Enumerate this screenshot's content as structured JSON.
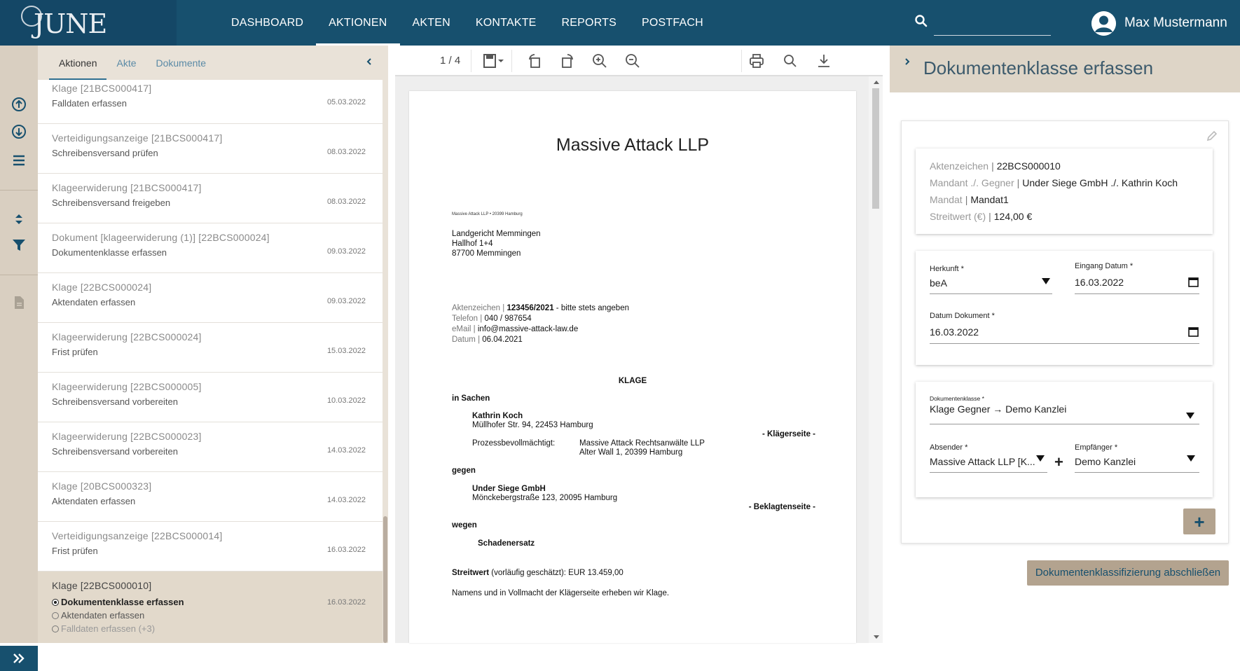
{
  "app": {
    "logo_text": "JUNE"
  },
  "nav": {
    "items": [
      {
        "label": "DASHBOARD"
      },
      {
        "label": "AKTIONEN"
      },
      {
        "label": "AKTEN"
      },
      {
        "label": "KONTAKTE"
      },
      {
        "label": "REPORTS"
      },
      {
        "label": "POSTFACH"
      }
    ],
    "active": "AKTIONEN"
  },
  "user": {
    "name": "Max Mustermann"
  },
  "list_panel": {
    "tabs": [
      {
        "label": "Aktionen"
      },
      {
        "label": "Akte"
      },
      {
        "label": "Dokumente"
      }
    ],
    "items": [
      {
        "title": "Klage [21BCS000417]",
        "sub": "Falldaten erfassen",
        "date": "05.03.2022"
      },
      {
        "title": "Verteidigungsanzeige [21BCS000417]",
        "sub": "Schreibensversand prüfen",
        "date": "08.03.2022"
      },
      {
        "title": "Klageerwiderung [21BCS000417]",
        "sub": "Schreibensversand freigeben",
        "date": "08.03.2022"
      },
      {
        "title": "Dokument [klageerwiderung (1)] [22BCS000024]",
        "sub": "Dokumentenklasse erfassen",
        "date": "09.03.2022"
      },
      {
        "title": "Klage [22BCS000024]",
        "sub": "Aktendaten erfassen",
        "date": "09.03.2022"
      },
      {
        "title": "Klageerwiderung [22BCS000024]",
        "sub": "Frist prüfen",
        "date": "15.03.2022"
      },
      {
        "title": "Klageerwiderung [22BCS000005]",
        "sub": "Schreibensversand vorbereiten",
        "date": "10.03.2022"
      },
      {
        "title": "Klageerwiderung [22BCS000023]",
        "sub": "Schreibensversand vorbereiten",
        "date": "14.03.2022"
      },
      {
        "title": "Klage [20BCS000323]",
        "sub": "Aktendaten erfassen",
        "date": "14.03.2022"
      },
      {
        "title": "Verteidigungsanzeige [22BCS000014]",
        "sub": "Frist prüfen",
        "date": "16.03.2022"
      }
    ],
    "selected": {
      "title": "Klage [22BCS000010]",
      "date": "16.03.2022",
      "steps": [
        {
          "label": "Dokumentenklasse erfassen"
        },
        {
          "label": "Aktendaten erfassen"
        },
        {
          "label": "Falldaten erfassen (+3)"
        }
      ]
    }
  },
  "viewer": {
    "page_indicator": "1 / 4",
    "document": {
      "firm": "Massive Attack LLP",
      "sender_line": "Massive Attack LLP • 20399 Hamburg",
      "recipient": [
        "Landgericht Memmingen",
        "Hallhof 1+4",
        "87700 Memmingen"
      ],
      "meta": [
        {
          "label": "Aktenzeichen |",
          "value": "123456/2021",
          "suffix": " - bitte stets angeben"
        },
        {
          "label": "Telefon |",
          "value": "040 / 987654",
          "suffix": ""
        },
        {
          "label": "eMail |",
          "value": "info@massive-attack-law.de",
          "suffix": ""
        },
        {
          "label": "Datum |",
          "value": "06.04.2021",
          "suffix": ""
        }
      ],
      "heading": "KLAGE",
      "in_sachen": "in Sachen",
      "plaintiff_name": "Kathrin Koch",
      "plaintiff_address": "Müllhofer Str. 94, 22453 Hamburg",
      "plaintiff_side": "- Klägerseite -",
      "counsel_label": "Prozessbevollmächtigt:",
      "counsel_name": "Massive Attack Rechtsanwälte LLP",
      "counsel_address": "Alter Wall 1, 20399 Hamburg",
      "gegen": "gegen",
      "defendant_name": "Under Siege GmbH",
      "defendant_address": "Mönckebergstraße 123, 20095 Hamburg",
      "defendant_side": "- Beklagtenseite -",
      "wegen": "wegen",
      "subject": "Schadenersatz",
      "streitwert_label": "Streitwert",
      "streitwert_text": " (vorläufig geschätzt): EUR 13.459,00",
      "closing": "Namens und in Vollmacht der Klägerseite erheben wir Klage."
    }
  },
  "right_panel": {
    "title": "Dokumentenklasse erfassen",
    "info": [
      {
        "label": "Aktenzeichen",
        "value": "22BCS000010"
      },
      {
        "label": "Mandant ./. Gegner",
        "value": "Under Siege GmbH ./. Kathrin Koch"
      },
      {
        "label": "Mandat",
        "value": "Mandat1"
      },
      {
        "label": "Streitwert (€)",
        "value": "124,00 €"
      }
    ],
    "herkunft": {
      "label": "Herkunft *",
      "value": "beA"
    },
    "eingang_datum": {
      "label": "Eingang Datum *",
      "value": "16.03.2022"
    },
    "datum_dokument": {
      "label": "Datum Dokument *",
      "value": "16.03.2022"
    },
    "dokumentenklasse": {
      "label": "Dokumentenklasse *",
      "value": "Klage  Gegner → Demo Kanzlei"
    },
    "absender": {
      "label": "Absender *",
      "value": "Massive Attack LLP [K..."
    },
    "empfaenger": {
      "label": "Empfänger *",
      "value": "Demo Kanzlei"
    },
    "add_label": "+",
    "finish_label": "Dokumentenklassifizierung abschließen"
  },
  "colors": {
    "topbar": "#17506e",
    "rail": "#d9cfc1",
    "panel_beige": "#e9e2d8",
    "button_beige": "#b3a38f",
    "accent_blue": "#5a8aa6"
  }
}
